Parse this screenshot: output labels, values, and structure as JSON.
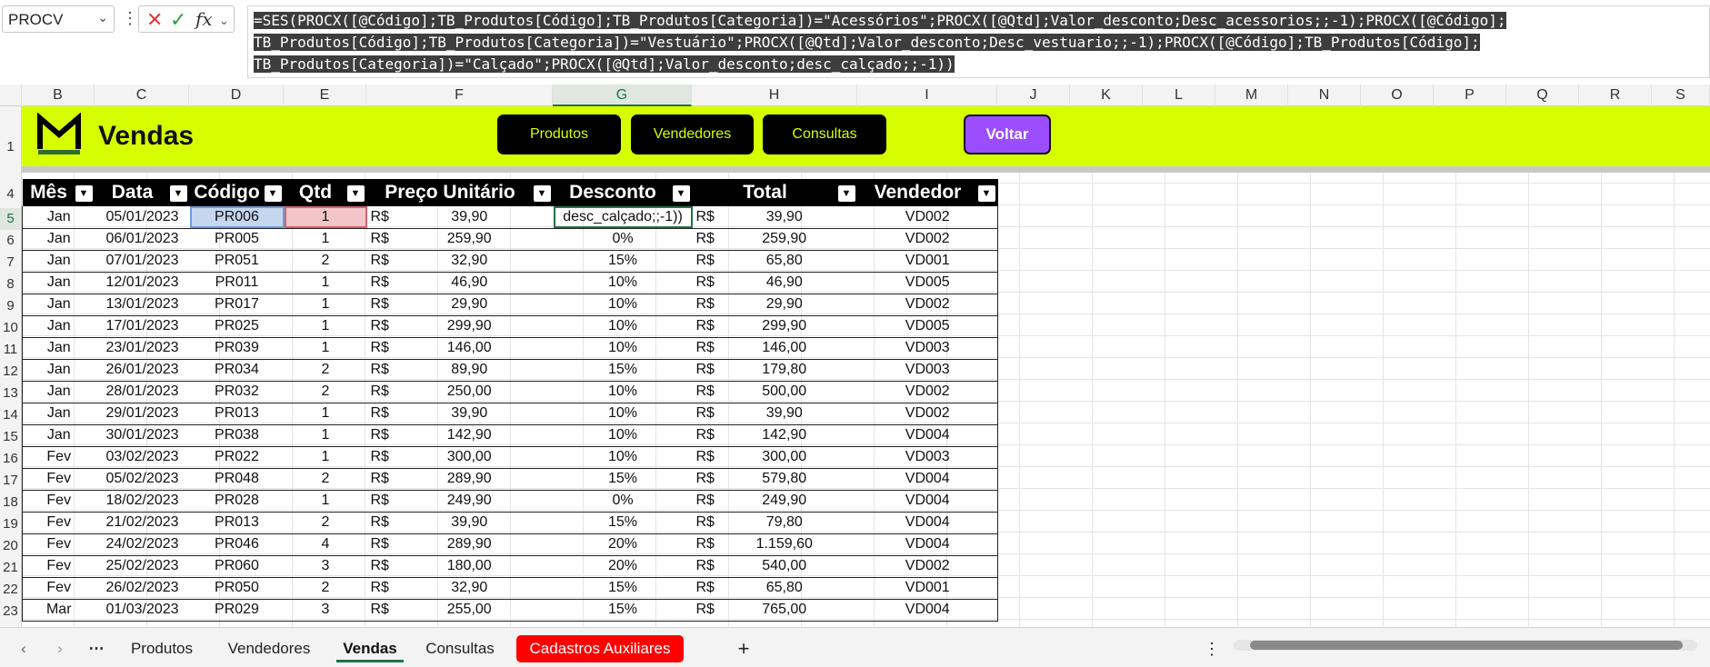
{
  "namebox": {
    "value": "PROCV"
  },
  "formula_lines": [
    "=SES(PROCX([@Código];TB_Produtos[Código];TB_Produtos[Categoria])=\"Acessórios\";PROCX([@Qtd];Valor_desconto;Desc_acessorios;;-1);PROCX([@Código];",
    "TB_Produtos[Código];TB_Produtos[Categoria])=\"Vestuário\";PROCX([@Qtd];Valor_desconto;Desc_vestuario;;-1);PROCX([@Código];TB_Produtos[Código];",
    "TB_Produtos[Categoria])=\"Calçado\";PROCX([@Qtd];Valor_desconto;desc_calçado;;-1))"
  ],
  "columns": [
    "B",
    "C",
    "D",
    "E",
    "F",
    "G",
    "H",
    "I",
    "J",
    "K",
    "L",
    "M",
    "N",
    "O",
    "P",
    "Q",
    "R",
    "S"
  ],
  "banner": {
    "title": "Vendas",
    "buttons": [
      "Produtos",
      "Vendedores",
      "Consultas"
    ],
    "back": "Voltar"
  },
  "table": {
    "headers": [
      "Mês",
      "Data",
      "Código",
      "Qtd",
      "Preço Unitário",
      "Desconto",
      "Total",
      "Vendedor"
    ],
    "currency": "R$",
    "rows": [
      {
        "r": "5",
        "mes": "Jan",
        "data": "05/01/2023",
        "cod": "PR006",
        "qtd": "1",
        "preco": "39,90",
        "desc": "desc_calçado;;-1))",
        "total": "39,90",
        "vend": "VD002"
      },
      {
        "r": "6",
        "mes": "Jan",
        "data": "06/01/2023",
        "cod": "PR005",
        "qtd": "1",
        "preco": "259,90",
        "desc": "0%",
        "total": "259,90",
        "vend": "VD002"
      },
      {
        "r": "7",
        "mes": "Jan",
        "data": "07/01/2023",
        "cod": "PR051",
        "qtd": "2",
        "preco": "32,90",
        "desc": "15%",
        "total": "65,80",
        "vend": "VD001"
      },
      {
        "r": "8",
        "mes": "Jan",
        "data": "12/01/2023",
        "cod": "PR011",
        "qtd": "1",
        "preco": "46,90",
        "desc": "10%",
        "total": "46,90",
        "vend": "VD005"
      },
      {
        "r": "9",
        "mes": "Jan",
        "data": "13/01/2023",
        "cod": "PR017",
        "qtd": "1",
        "preco": "29,90",
        "desc": "10%",
        "total": "29,90",
        "vend": "VD002"
      },
      {
        "r": "10",
        "mes": "Jan",
        "data": "17/01/2023",
        "cod": "PR025",
        "qtd": "1",
        "preco": "299,90",
        "desc": "10%",
        "total": "299,90",
        "vend": "VD005"
      },
      {
        "r": "11",
        "mes": "Jan",
        "data": "23/01/2023",
        "cod": "PR039",
        "qtd": "1",
        "preco": "146,00",
        "desc": "10%",
        "total": "146,00",
        "vend": "VD003"
      },
      {
        "r": "12",
        "mes": "Jan",
        "data": "26/01/2023",
        "cod": "PR034",
        "qtd": "2",
        "preco": "89,90",
        "desc": "15%",
        "total": "179,80",
        "vend": "VD003"
      },
      {
        "r": "13",
        "mes": "Jan",
        "data": "28/01/2023",
        "cod": "PR032",
        "qtd": "2",
        "preco": "250,00",
        "desc": "10%",
        "total": "500,00",
        "vend": "VD002"
      },
      {
        "r": "14",
        "mes": "Jan",
        "data": "29/01/2023",
        "cod": "PR013",
        "qtd": "1",
        "preco": "39,90",
        "desc": "10%",
        "total": "39,90",
        "vend": "VD002"
      },
      {
        "r": "15",
        "mes": "Jan",
        "data": "30/01/2023",
        "cod": "PR038",
        "qtd": "1",
        "preco": "142,90",
        "desc": "10%",
        "total": "142,90",
        "vend": "VD004"
      },
      {
        "r": "16",
        "mes": "Fev",
        "data": "03/02/2023",
        "cod": "PR022",
        "qtd": "1",
        "preco": "300,00",
        "desc": "10%",
        "total": "300,00",
        "vend": "VD003"
      },
      {
        "r": "17",
        "mes": "Fev",
        "data": "05/02/2023",
        "cod": "PR048",
        "qtd": "2",
        "preco": "289,90",
        "desc": "15%",
        "total": "579,80",
        "vend": "VD004"
      },
      {
        "r": "18",
        "mes": "Fev",
        "data": "18/02/2023",
        "cod": "PR028",
        "qtd": "1",
        "preco": "249,90",
        "desc": "0%",
        "total": "249,90",
        "vend": "VD004"
      },
      {
        "r": "19",
        "mes": "Fev",
        "data": "21/02/2023",
        "cod": "PR013",
        "qtd": "2",
        "preco": "39,90",
        "desc": "15%",
        "total": "79,80",
        "vend": "VD004"
      },
      {
        "r": "20",
        "mes": "Fev",
        "data": "24/02/2023",
        "cod": "PR046",
        "qtd": "4",
        "preco": "289,90",
        "desc": "20%",
        "total": "1.159,60",
        "vend": "VD004"
      },
      {
        "r": "21",
        "mes": "Fev",
        "data": "25/02/2023",
        "cod": "PR060",
        "qtd": "3",
        "preco": "180,00",
        "desc": "20%",
        "total": "540,00",
        "vend": "VD002"
      },
      {
        "r": "22",
        "mes": "Fev",
        "data": "26/02/2023",
        "cod": "PR050",
        "qtd": "2",
        "preco": "32,90",
        "desc": "15%",
        "total": "65,80",
        "vend": "VD001"
      },
      {
        "r": "23",
        "mes": "Mar",
        "data": "01/03/2023",
        "cod": "PR029",
        "qtd": "3",
        "preco": "255,00",
        "desc": "15%",
        "total": "765,00",
        "vend": "VD004"
      }
    ]
  },
  "row_headers": [
    "1",
    "4",
    "5",
    "6",
    "7",
    "8",
    "9",
    "10",
    "11",
    "12",
    "13",
    "14",
    "15",
    "16",
    "17",
    "18",
    "19",
    "20",
    "21",
    "22",
    "23"
  ],
  "sheet_tabs": [
    "Produtos",
    "Vendedores",
    "Vendas",
    "Consultas",
    "Cadastros Auxiliares"
  ],
  "active_tab": "Vendas",
  "colors": {
    "banner": "#d7fe00",
    "voltar": "#9b4dff",
    "aux_tab": "#ff0000",
    "excel_green": "#217346"
  },
  "icons": [
    "chevron-down-icon",
    "more-vertical-icon",
    "cancel-icon",
    "enter-icon",
    "function-icon",
    "nav-left-icon",
    "nav-right-icon",
    "more-tabs-icon",
    "add-sheet-icon"
  ]
}
